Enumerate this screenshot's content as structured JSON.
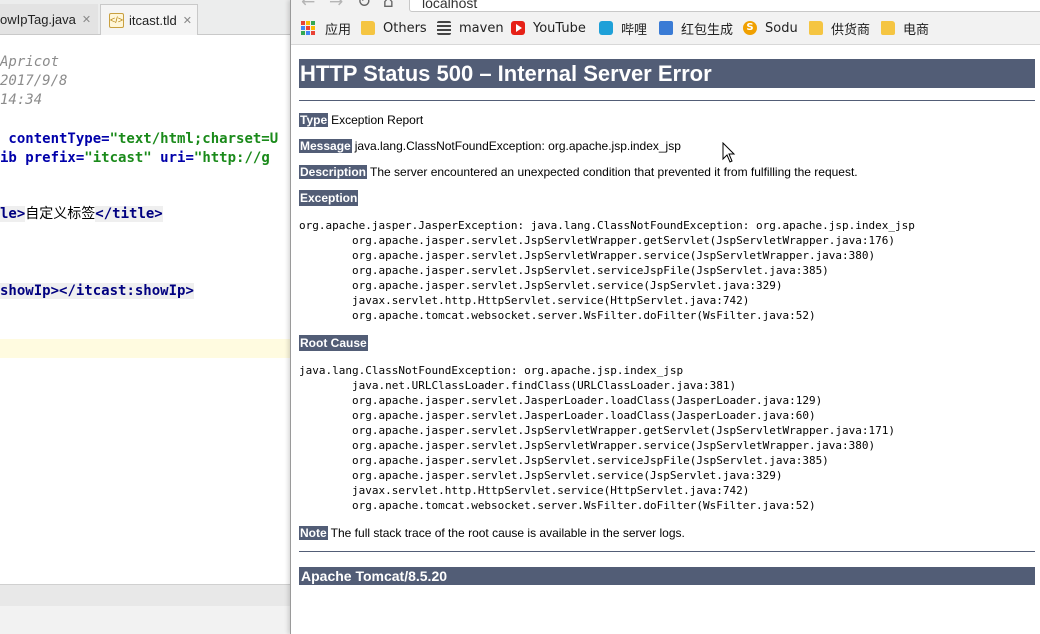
{
  "ide": {
    "tabs": [
      {
        "label": "owIpTag.java"
      },
      {
        "label": "itcast.tld"
      }
    ],
    "code": {
      "line1": "Apricot",
      "line2": "2017/9/8",
      "line3": "14:34",
      "l4_attr1": " contentType=",
      "l4_str1": "\"text/html;charset=U",
      "l5_kw": "ib",
      "l5_attr1": " prefix=",
      "l5_str1": "\"itcast\"",
      "l5_attr2": " uri=",
      "l5_str2": "\"http://g",
      "l6_tag_end": "le>",
      "l6_text": "自定义标签",
      "l6_close": "</title>",
      "l7_tag": "showIp>",
      "l7_close": "</itcast:showIp>"
    }
  },
  "browser": {
    "url": "localhost",
    "bookmarks": [
      {
        "label": "应用"
      },
      {
        "label": "Others"
      },
      {
        "label": "maven"
      },
      {
        "label": "YouTube"
      },
      {
        "label": "哔哩"
      },
      {
        "label": "红包生成"
      },
      {
        "label": "Sodu"
      },
      {
        "label": "供货商"
      },
      {
        "label": "电商"
      }
    ],
    "page": {
      "title": "HTTP Status 500 – Internal Server Error",
      "type_label": "Type",
      "type_value": "Exception Report",
      "message_label": "Message",
      "message_value": "java.lang.ClassNotFoundException: org.apache.jsp.index_jsp",
      "description_label": "Description",
      "description_value": "The server encountered an unexpected condition that prevented it from fulfilling the request.",
      "exception_label": "Exception",
      "exception_trace": "org.apache.jasper.JasperException: java.lang.ClassNotFoundException: org.apache.jsp.index_jsp\n\torg.apache.jasper.servlet.JspServletWrapper.getServlet(JspServletWrapper.java:176)\n\torg.apache.jasper.servlet.JspServletWrapper.service(JspServletWrapper.java:380)\n\torg.apache.jasper.servlet.JspServlet.serviceJspFile(JspServlet.java:385)\n\torg.apache.jasper.servlet.JspServlet.service(JspServlet.java:329)\n\tjavax.servlet.http.HttpServlet.service(HttpServlet.java:742)\n\torg.apache.tomcat.websocket.server.WsFilter.doFilter(WsFilter.java:52)",
      "root_cause_label": "Root Cause",
      "root_cause_trace": "java.lang.ClassNotFoundException: org.apache.jsp.index_jsp\n\tjava.net.URLClassLoader.findClass(URLClassLoader.java:381)\n\torg.apache.jasper.servlet.JasperLoader.loadClass(JasperLoader.java:129)\n\torg.apache.jasper.servlet.JasperLoader.loadClass(JasperLoader.java:60)\n\torg.apache.jasper.servlet.JspServletWrapper.getServlet(JspServletWrapper.java:171)\n\torg.apache.jasper.servlet.JspServletWrapper.service(JspServletWrapper.java:380)\n\torg.apache.jasper.servlet.JspServlet.serviceJspFile(JspServlet.java:385)\n\torg.apache.jasper.servlet.JspServlet.service(JspServlet.java:329)\n\tjavax.servlet.http.HttpServlet.service(HttpServlet.java:742)\n\torg.apache.tomcat.websocket.server.WsFilter.doFilter(WsFilter.java:52)",
      "note_label": "Note",
      "note_value": "The full stack trace of the root cause is available in the server logs.",
      "footer": "Apache Tomcat/8.5.20"
    }
  },
  "colors": {
    "tomcat_bar": "#525d76",
    "code_string": "#1a8a1a",
    "code_attr": "#0000aa",
    "code_tag": "#000080"
  }
}
